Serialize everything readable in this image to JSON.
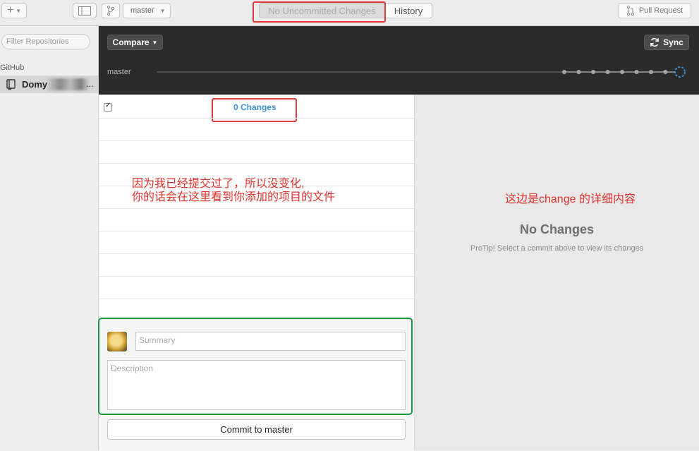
{
  "toolbar": {
    "add_symbol": "+",
    "branch": "master",
    "uncommitted_tab": "No Uncommitted Changes",
    "history_tab": "History",
    "pull_request": "Pull Request"
  },
  "sidebar": {
    "filter_placeholder": "Filter Repositories",
    "section_label": "GitHub",
    "repo_name": "Domy",
    "repo_suffix": "..."
  },
  "header": {
    "compare_label": "Compare",
    "sync_label": "Sync",
    "branch_label": "master",
    "timeline_commits": 8
  },
  "changes": {
    "count_label": "0 Changes",
    "summary_placeholder": "Summary",
    "description_placeholder": "Description",
    "commit_button": "Commit to master"
  },
  "detail": {
    "title": "No Changes",
    "tip": "ProTip! Select a commit above to view its changes"
  },
  "annotations": {
    "left_line1": "因为我已经提交过了，所以没变化,",
    "left_line2": "你的话会在这里看到你添加的项目的文件",
    "right": "这边是change 的详细内容"
  },
  "colors": {
    "accent_blue": "#3b8fd6",
    "annotation_red": "#e0322a",
    "annotation_green": "#1a9a3a",
    "dark_header": "#2b2b2b"
  }
}
